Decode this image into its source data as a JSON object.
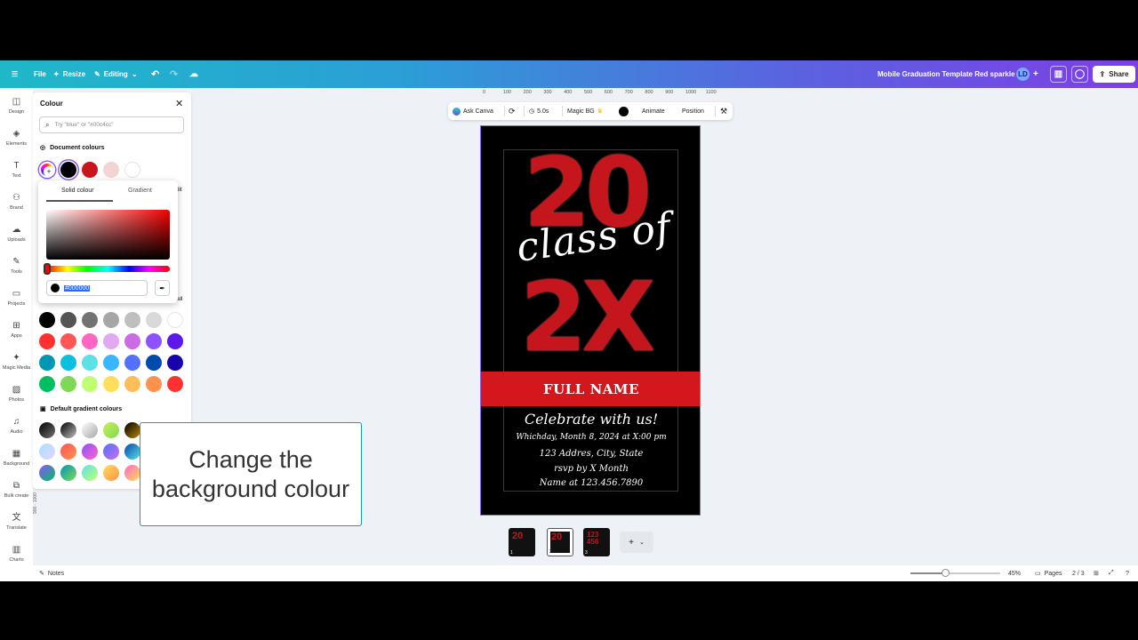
{
  "topbar": {
    "file": "File",
    "resize": "Resize",
    "editing": "Editing",
    "doc_title": "Mobile Graduation Template Red  sparkle",
    "avatar": "LD",
    "share": "Share"
  },
  "sidebar": {
    "items": [
      {
        "label": "Design",
        "icon": "design-icon",
        "glyph": "◫"
      },
      {
        "label": "Elements",
        "icon": "elements-icon",
        "glyph": "◈"
      },
      {
        "label": "Text",
        "icon": "text-icon",
        "glyph": "T"
      },
      {
        "label": "Brand",
        "icon": "brand-icon",
        "glyph": "⚇"
      },
      {
        "label": "Uploads",
        "icon": "uploads-icon",
        "glyph": "☁"
      },
      {
        "label": "Tools",
        "icon": "tools-icon",
        "glyph": "✎"
      },
      {
        "label": "Projects",
        "icon": "projects-icon",
        "glyph": "▭"
      },
      {
        "label": "Apps",
        "icon": "apps-icon",
        "glyph": "⊞"
      },
      {
        "label": "Magic Media",
        "icon": "magic-media-icon",
        "glyph": "✦"
      },
      {
        "label": "Photos",
        "icon": "photos-icon",
        "glyph": "▨"
      },
      {
        "label": "Audio",
        "icon": "audio-icon",
        "glyph": "♫"
      },
      {
        "label": "Background",
        "icon": "background-icon",
        "glyph": "▦"
      },
      {
        "label": "Bulk create",
        "icon": "bulk-create-icon",
        "glyph": "⧉"
      },
      {
        "label": "Translate",
        "icon": "translate-icon",
        "glyph": "文"
      },
      {
        "label": "Charts",
        "icon": "charts-icon",
        "glyph": "▥"
      }
    ]
  },
  "colour_panel": {
    "title": "Colour",
    "search_placeholder": "Try \"blue\" or \"#00c4cc\"",
    "document_colours_label": "Document colours",
    "document_colours": [
      "#000000",
      "#c8161d",
      "#f2d4d4",
      "#ffffff"
    ],
    "edit_partial": "dit",
    "all_partial": "all",
    "solid_rows": [
      [
        "#000000",
        "#545454",
        "#737373",
        "#a6a6a6",
        "#bfbfbf",
        "#d9d9d9",
        "#ffffff"
      ],
      [
        "#ff3131",
        "#ff5757",
        "#ff66c4",
        "#e2a9f1",
        "#cb6ce6",
        "#8c52ff",
        "#5e17eb"
      ],
      [
        "#0097b2",
        "#0cc0df",
        "#5ce1e6",
        "#38b6ff",
        "#5271ff",
        "#004aad",
        "#1800ad"
      ],
      [
        "#00bf63",
        "#7ed957",
        "#c1ff72",
        "#ffde59",
        "#ffbd59",
        "#ff914d",
        "#ff3131"
      ]
    ],
    "gradient_label": "Default gradient colours",
    "gradient_rows": [
      [
        "linear-gradient(135deg,#000,#737373)",
        "linear-gradient(135deg,#000,#c0c0c0)",
        "linear-gradient(135deg,#fff,#a6a6a6)",
        "linear-gradient(135deg,#c9f05a,#7ed957)",
        "linear-gradient(135deg,#000,#b8860b)"
      ],
      [
        "linear-gradient(135deg,#a6e1ff,#e9d4ff)",
        "linear-gradient(135deg,#ff5757,#ff914d)",
        "linear-gradient(135deg,#8c52ff,#ff66c4)",
        "linear-gradient(135deg,#5271ff,#cb6ce6)",
        "linear-gradient(135deg,#004aad,#5de0e6)"
      ],
      [
        "linear-gradient(135deg,#8c52ff,#00bf63)",
        "linear-gradient(135deg,#0097b2,#7ed957)",
        "linear-gradient(135deg,#5ce1e6,#c1ff72)",
        "linear-gradient(135deg,#ffde59,#ff914d)",
        "linear-gradient(135deg,#ff66c4,#ffde59)",
        "linear-gradient(135deg,#fff3b0,#e2a9f1)",
        "linear-gradient(135deg,#ff914d,#8c52ff)"
      ]
    ]
  },
  "picker": {
    "tab_solid": "Solid colour",
    "tab_gradient": "Gradient",
    "hex_value": "#000000",
    "hue_value_deg": 0
  },
  "ruler": [
    "0",
    "100",
    "200",
    "300",
    "400",
    "500",
    "600",
    "700",
    "800",
    "900",
    "1000",
    "1100"
  ],
  "ruler_left": "900 · 1000",
  "toolbar": {
    "ask_canva": "Ask Canva",
    "duration": "5.0s",
    "magic_bg": "Magic BG",
    "animate": "Animate",
    "position": "Position"
  },
  "design": {
    "num_top": "20",
    "num_bottom": "2X",
    "script": "class of",
    "name": "FULL NAME",
    "celebrate": "Celebrate with us!",
    "date": "Whichday, Month 8, 2024 at X:00 pm",
    "address": "123 Addres, City, State",
    "rsvp": "rsvp by X Month",
    "contact": "Name at 123.456.7890"
  },
  "pages": {
    "thumbs": [
      "1",
      "2",
      "3"
    ],
    "current": "2 / 3",
    "label": "Pages"
  },
  "bottombar": {
    "notes": "Notes",
    "zoom": "45%",
    "zoom_level": 0.45
  },
  "callout": "Change the background colour",
  "colors": {
    "accent": "#8b5cf6",
    "brand_red": "#d4161d",
    "callout_border": "#13a3a0"
  }
}
